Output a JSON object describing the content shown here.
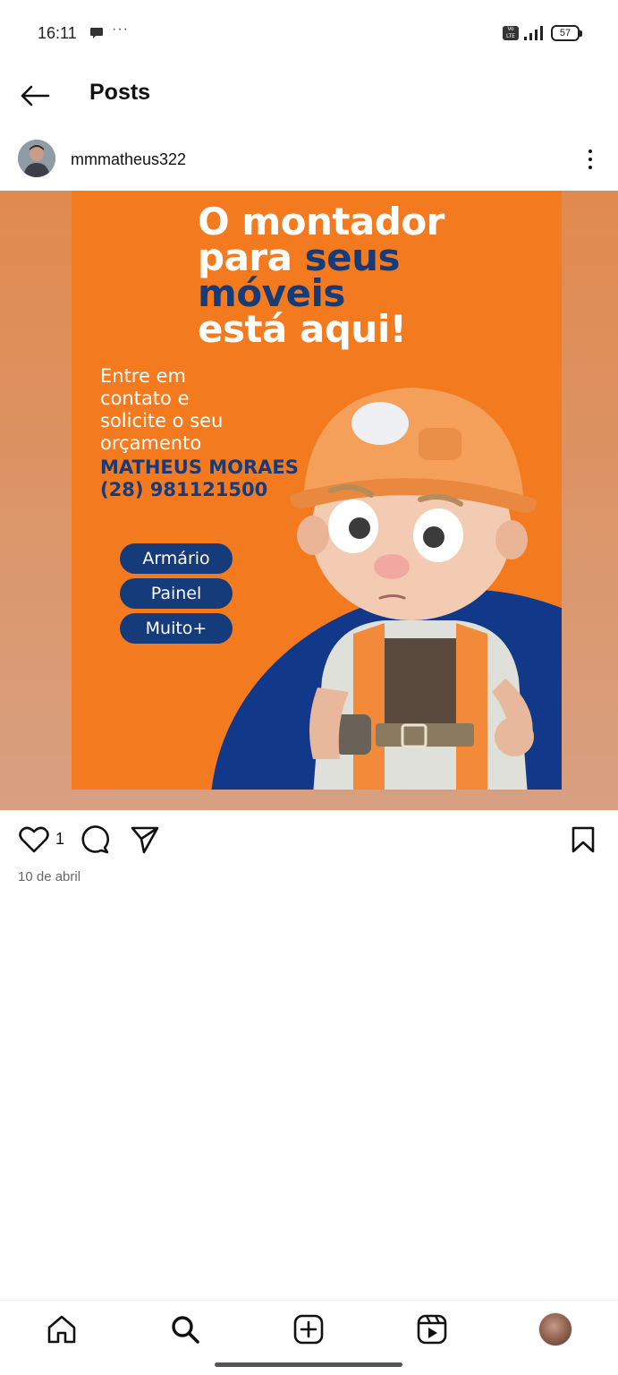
{
  "status_bar": {
    "time": "16:11",
    "dots": "···",
    "volte": "Vo LTE",
    "battery": "57"
  },
  "header": {
    "title": "Posts",
    "back_icon": "arrow-left-icon"
  },
  "post": {
    "username": "mmmatheus322",
    "likes": "1",
    "date": "10 de abril",
    "flyer": {
      "headline_line1": "O montador",
      "headline_line2_a": "para ",
      "headline_line2_b": "seus",
      "headline_line3": "móveis",
      "headline_line4": "está aqui!",
      "sub_line1": "Entre em",
      "sub_line2": "contato e",
      "sub_line3": "solicite o seu",
      "sub_line4": "orçamento",
      "name": "MATHEUS MORAES",
      "phone": "(28) 981121500",
      "pills": [
        "Armário",
        "Painel",
        "Muito+"
      ]
    }
  },
  "nav": {
    "items": [
      "home-icon",
      "search-icon",
      "create-icon",
      "reels-icon",
      "profile-avatar"
    ]
  },
  "colors": {
    "flyer_orange": "#f47a20",
    "flyer_blue": "#163b7a",
    "background": "#ffffff"
  }
}
